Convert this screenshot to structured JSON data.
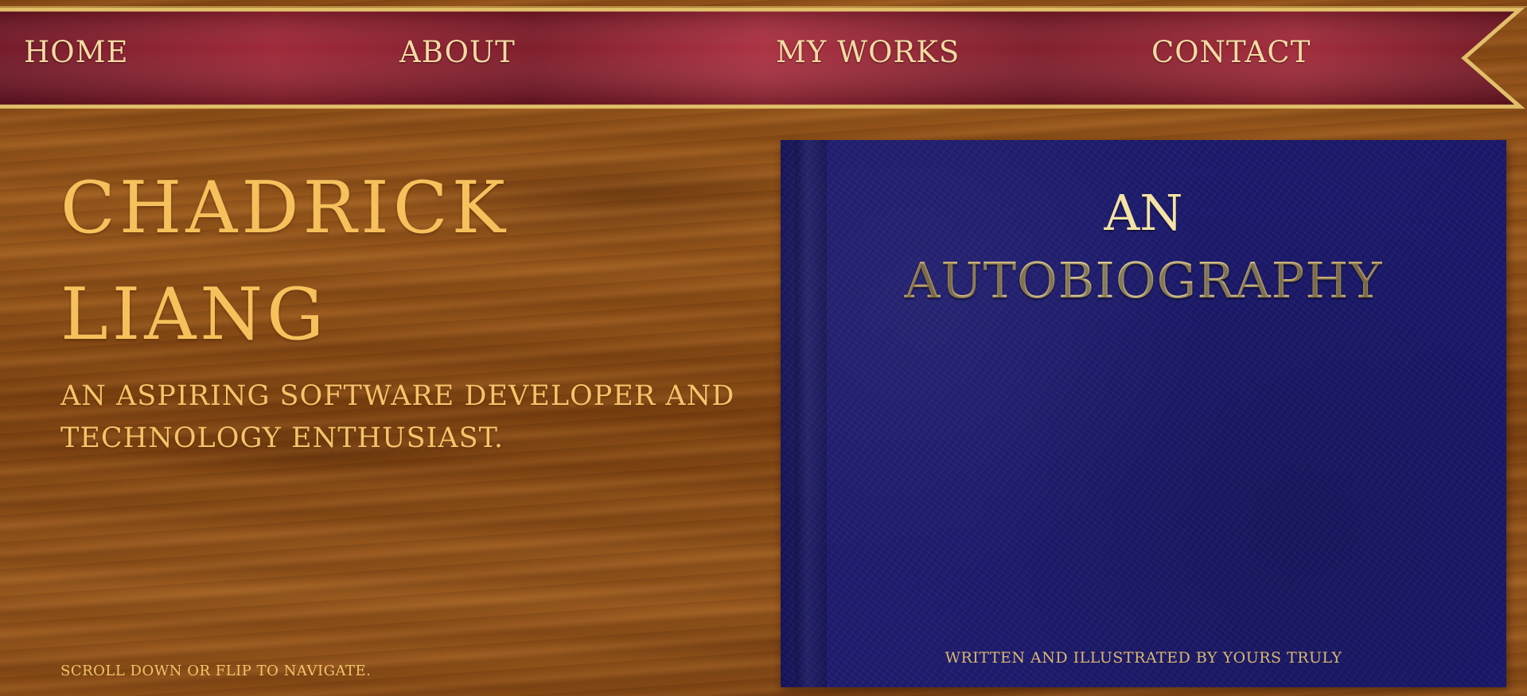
{
  "nav": {
    "items": [
      {
        "label": "HOME"
      },
      {
        "label": "ABOUT"
      },
      {
        "label": "MY WORKS"
      },
      {
        "label": "CONTACT"
      }
    ]
  },
  "hero": {
    "name_line1": "CHADRICK",
    "name_line2": "LIANG",
    "tagline": "AN ASPIRING SOFTWARE DEVELOPER AND TECHNOLOGY ENTHUSIAST.",
    "hint": "SCROLL DOWN OR FLIP TO NAVIGATE."
  },
  "book": {
    "title_line1": "AN",
    "title_line2": "AUTOBIOGRAPHY",
    "byline": "WRITTEN AND ILLUSTRATED BY YOURS TRULY"
  },
  "colors": {
    "ribbon": "#8c1a2a",
    "gold": "#e8c66a",
    "wood": "#8a4a12",
    "book_cover": "#1c1a68",
    "hero_text": "#f6c15c"
  }
}
